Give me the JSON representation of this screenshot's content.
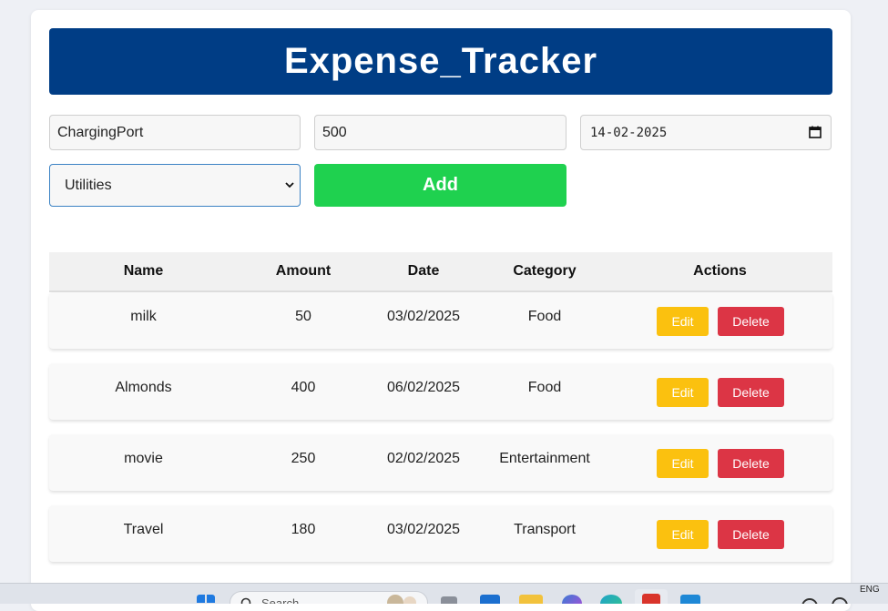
{
  "app": {
    "title": "Expense_Tracker"
  },
  "form": {
    "name_value": "ChargingPort",
    "amount_value": "500",
    "date_value": "14-02-2025",
    "category_selected": "Utilities",
    "add_label": "Add"
  },
  "table": {
    "headers": {
      "name": "Name",
      "amount": "Amount",
      "date": "Date",
      "category": "Category",
      "actions": "Actions"
    },
    "rows": [
      {
        "name": "milk",
        "amount": "50",
        "date": "03/02/2025",
        "category": "Food",
        "edit": "Edit",
        "delete": "Delete"
      },
      {
        "name": "Almonds",
        "amount": "400",
        "date": "06/02/2025",
        "category": "Food",
        "edit": "Edit",
        "delete": "Delete"
      },
      {
        "name": "movie",
        "amount": "250",
        "date": "02/02/2025",
        "category": "Entertainment",
        "edit": "Edit",
        "delete": "Delete"
      },
      {
        "name": "Travel",
        "amount": "180",
        "date": "03/02/2025",
        "category": "Transport",
        "edit": "Edit",
        "delete": "Delete"
      }
    ]
  },
  "taskbar": {
    "search_placeholder": "Search",
    "language": "ENG",
    "icons": [
      "windows-start-icon",
      "search-icon",
      "widget-icon",
      "task-view-icon",
      "store-icon",
      "file-explorer-icon",
      "copilot-icon",
      "edge-icon",
      "app-icon",
      "vscode-icon",
      "tray-icon"
    ]
  },
  "colors": {
    "header_bg": "#003d85",
    "add_button": "#1fd14f",
    "edit_button": "#fbc10f",
    "delete_button": "#dc3545",
    "page_bg": "#eef0f5"
  }
}
